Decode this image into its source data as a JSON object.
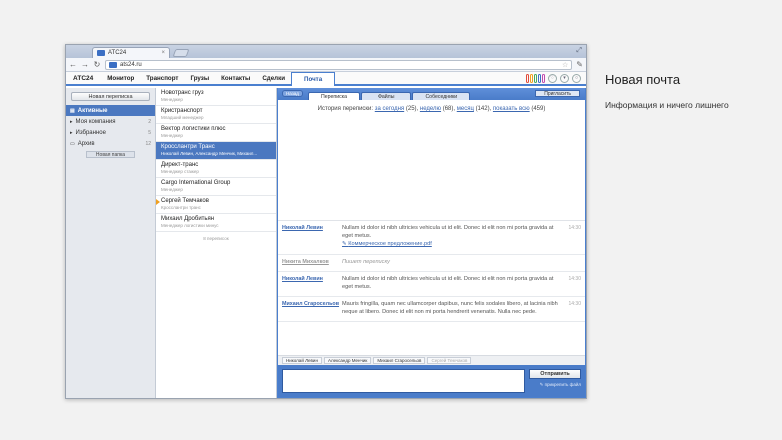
{
  "browser": {
    "tab_title": "АТС24",
    "url": "ats24.ru"
  },
  "header": {
    "logo": "АТС24",
    "menu": [
      "Монитор",
      "Транспорт",
      "Грузы",
      "Контакты",
      "Сделки",
      "Почта"
    ],
    "active_menu": "Почта",
    "clip_colors": [
      "#e04a3a",
      "#f0a020",
      "#4aa85c",
      "#3b6fc4",
      "#c04ab0"
    ]
  },
  "sidebar": {
    "new_button": "Новая переписка",
    "items": [
      {
        "label": "Активные",
        "count": ""
      },
      {
        "label": "Моя компания",
        "count": "2"
      },
      {
        "label": "Избранное",
        "count": "5"
      },
      {
        "label": "Архив",
        "count": "12"
      }
    ],
    "new_folder": "Новая папка"
  },
  "contacts": {
    "items": [
      {
        "name": "Новотранс груз",
        "sub": "Менеджер"
      },
      {
        "name": "Кристранспорт",
        "sub": "Младший менеджер"
      },
      {
        "name": "Вектор логистики плюс",
        "sub": "Менеджер"
      },
      {
        "name": "Кросслантри Транс",
        "sub": "Николай Левин, Александр Менчик, Михаил..."
      },
      {
        "name": "Директ-транс",
        "sub": "Менеджер стажер"
      },
      {
        "name": "Cargo International Group",
        "sub": "Менеджер"
      },
      {
        "name": "Сергей Темчаков",
        "sub": "Кросслантри транс"
      },
      {
        "name": "Михаил Дробитьян",
        "sub": "Менеджер логистики минус"
      }
    ],
    "footer": "8 переписок"
  },
  "main": {
    "back": "Назад",
    "tabs": [
      "Переписка",
      "Файлы",
      "Собеседники"
    ],
    "invite": "Пригласить",
    "history_prefix": "История переписки:",
    "history_links": [
      "за сегодня",
      "неделю",
      "месяц",
      "показать всю"
    ],
    "history_counts": [
      "(25),",
      "(68),",
      "(142),",
      "(459)"
    ],
    "messages": [
      {
        "from": "Николай Левин",
        "text": "Nullam id dolor id nibh ultricies vehicula ut id elit. Donec id elit non mi porta gravida at eget metus.",
        "attach": "Коммерческое предложение.pdf",
        "time": "14:30"
      },
      {
        "from": "Никита Михалков",
        "text": "Пишет переписку",
        "time": ""
      },
      {
        "from": "Николай Левин",
        "text": "Nullam id dolor id nibh ultricies vehicula ut id elit. Donec id elit non mi porta gravida at eget metus.",
        "time": "14:30"
      },
      {
        "from": "Михаил Сгаросельов",
        "text": "Mauris fringilla, quam nec ullamcorper dapibus, nunc felis sodales libero, at lacinia nibh neque at libero. Donec id elit non mi porta hendrerit venenatis. Nulla nec pede.",
        "time": "14:30"
      }
    ],
    "recipients": [
      "Николай Левин",
      "Александр Менчик",
      "Михаил Сгаросельов",
      "Сергей Темчаков"
    ],
    "send": "Отправить",
    "attach_file": "прикрепить файл"
  },
  "side": {
    "title": "Новая почта",
    "subtitle": "Информация и ничего лишнего"
  }
}
